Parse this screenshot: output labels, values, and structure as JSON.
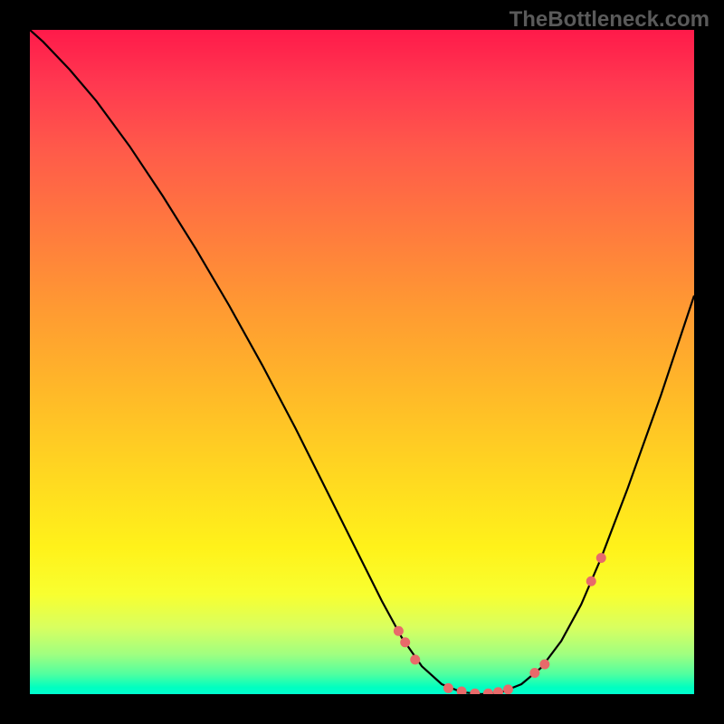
{
  "watermark": "TheBottleneck.com",
  "chart_data": {
    "type": "line",
    "title": "",
    "xlabel": "",
    "ylabel": "",
    "xlim": [
      0,
      100
    ],
    "ylim": [
      0,
      100
    ],
    "curve": [
      {
        "x": 0,
        "y": 100
      },
      {
        "x": 2,
        "y": 98.2
      },
      {
        "x": 6,
        "y": 94.0
      },
      {
        "x": 10,
        "y": 89.3
      },
      {
        "x": 15,
        "y": 82.5
      },
      {
        "x": 20,
        "y": 75.0
      },
      {
        "x": 25,
        "y": 67.0
      },
      {
        "x": 30,
        "y": 58.5
      },
      {
        "x": 35,
        "y": 49.5
      },
      {
        "x": 40,
        "y": 40.0
      },
      {
        "x": 45,
        "y": 30.0
      },
      {
        "x": 50,
        "y": 20.0
      },
      {
        "x": 53,
        "y": 14.0
      },
      {
        "x": 56,
        "y": 8.5
      },
      {
        "x": 59,
        "y": 4.2
      },
      {
        "x": 62,
        "y": 1.5
      },
      {
        "x": 65,
        "y": 0.3
      },
      {
        "x": 68,
        "y": 0.0
      },
      {
        "x": 71,
        "y": 0.3
      },
      {
        "x": 74,
        "y": 1.5
      },
      {
        "x": 77,
        "y": 4.0
      },
      {
        "x": 80,
        "y": 8.0
      },
      {
        "x": 83,
        "y": 13.5
      },
      {
        "x": 86,
        "y": 20.5
      },
      {
        "x": 90,
        "y": 31.0
      },
      {
        "x": 95,
        "y": 45.0
      },
      {
        "x": 100,
        "y": 60.0
      }
    ],
    "markers": [
      {
        "x": 55.5,
        "y": 9.5,
        "size": "small"
      },
      {
        "x": 56.5,
        "y": 7.8,
        "size": "small"
      },
      {
        "x": 58.0,
        "y": 5.2,
        "size": "small"
      },
      {
        "x": 63.0,
        "y": 0.9,
        "size": "small"
      },
      {
        "x": 65.0,
        "y": 0.4,
        "size": "small"
      },
      {
        "x": 67.0,
        "y": 0.1,
        "size": "small"
      },
      {
        "x": 69.0,
        "y": 0.1,
        "size": "small"
      },
      {
        "x": 70.5,
        "y": 0.3,
        "size": "small"
      },
      {
        "x": 72.0,
        "y": 0.7,
        "size": "small"
      },
      {
        "x": 76.0,
        "y": 3.2,
        "size": "small"
      },
      {
        "x": 77.5,
        "y": 4.5,
        "size": "small"
      },
      {
        "x": 84.5,
        "y": 17.0,
        "size": "small"
      },
      {
        "x": 86.0,
        "y": 20.5,
        "size": "small"
      }
    ],
    "marker_color": "#e86a6a",
    "curve_color": "#000000"
  }
}
